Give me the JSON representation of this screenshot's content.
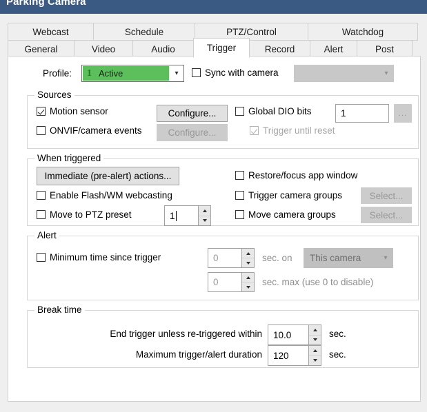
{
  "window": {
    "title": "Parking Camera",
    "titlebar_color": "#3a5a84"
  },
  "tabs": {
    "row1": [
      {
        "label": "Webcast",
        "selected": false
      },
      {
        "label": "Schedule",
        "selected": false
      },
      {
        "label": "PTZ/Control",
        "selected": false
      },
      {
        "label": "Watchdog",
        "selected": false
      }
    ],
    "row2": [
      {
        "label": "General",
        "selected": false
      },
      {
        "label": "Video",
        "selected": false
      },
      {
        "label": "Audio",
        "selected": false
      },
      {
        "label": "Trigger",
        "selected": true
      },
      {
        "label": "Record",
        "selected": false
      },
      {
        "label": "Alert",
        "selected": false
      },
      {
        "label": "Post",
        "selected": false
      }
    ]
  },
  "profile": {
    "label": "Profile:",
    "number": "1",
    "value": "Active",
    "highlight_color": "#5cbf5c",
    "sync_checkbox_label": "Sync with camera",
    "sync_checked": false,
    "sync_combo_value": ""
  },
  "sources": {
    "title": "Sources",
    "motion_sensor_label": "Motion sensor",
    "motion_sensor_checked": true,
    "motion_configure_label": "Configure...",
    "onvif_label": "ONVIF/camera events",
    "onvif_checked": false,
    "onvif_configure_label": "Configure...",
    "global_dio_label": "Global DIO bits",
    "global_dio_checked": false,
    "global_dio_value": "1",
    "dio_browse_label": "...",
    "trigger_until_reset_label": "Trigger until reset",
    "trigger_until_reset_checked": true
  },
  "when_triggered": {
    "title": "When triggered",
    "immediate_actions_label": "Immediate (pre-alert) actions...",
    "flash_wm_label": "Enable Flash/WM webcasting",
    "flash_wm_checked": false,
    "ptz_preset_label": "Move to PTZ preset",
    "ptz_preset_checked": false,
    "ptz_preset_value": "1",
    "restore_focus_label": "Restore/focus app window",
    "restore_focus_checked": false,
    "trigger_groups_label": "Trigger camera groups",
    "trigger_groups_checked": false,
    "trigger_groups_button": "Select...",
    "move_groups_label": "Move camera groups",
    "move_groups_checked": false,
    "move_groups_button": "Select..."
  },
  "alert": {
    "title": "Alert",
    "min_time_label": "Minimum time since trigger",
    "min_time_checked": false,
    "min_time_value": "0",
    "sec_on_label": "sec. on",
    "camera_select_value": "This camera",
    "max_time_value": "0",
    "sec_max_label": "sec. max (use 0 to disable)"
  },
  "break_time": {
    "title": "Break time",
    "end_trigger_label": "End trigger unless re-triggered within",
    "end_trigger_value": "10.0",
    "end_trigger_unit": "sec.",
    "max_duration_label": "Maximum trigger/alert duration",
    "max_duration_value": "120",
    "max_duration_unit": "sec."
  }
}
